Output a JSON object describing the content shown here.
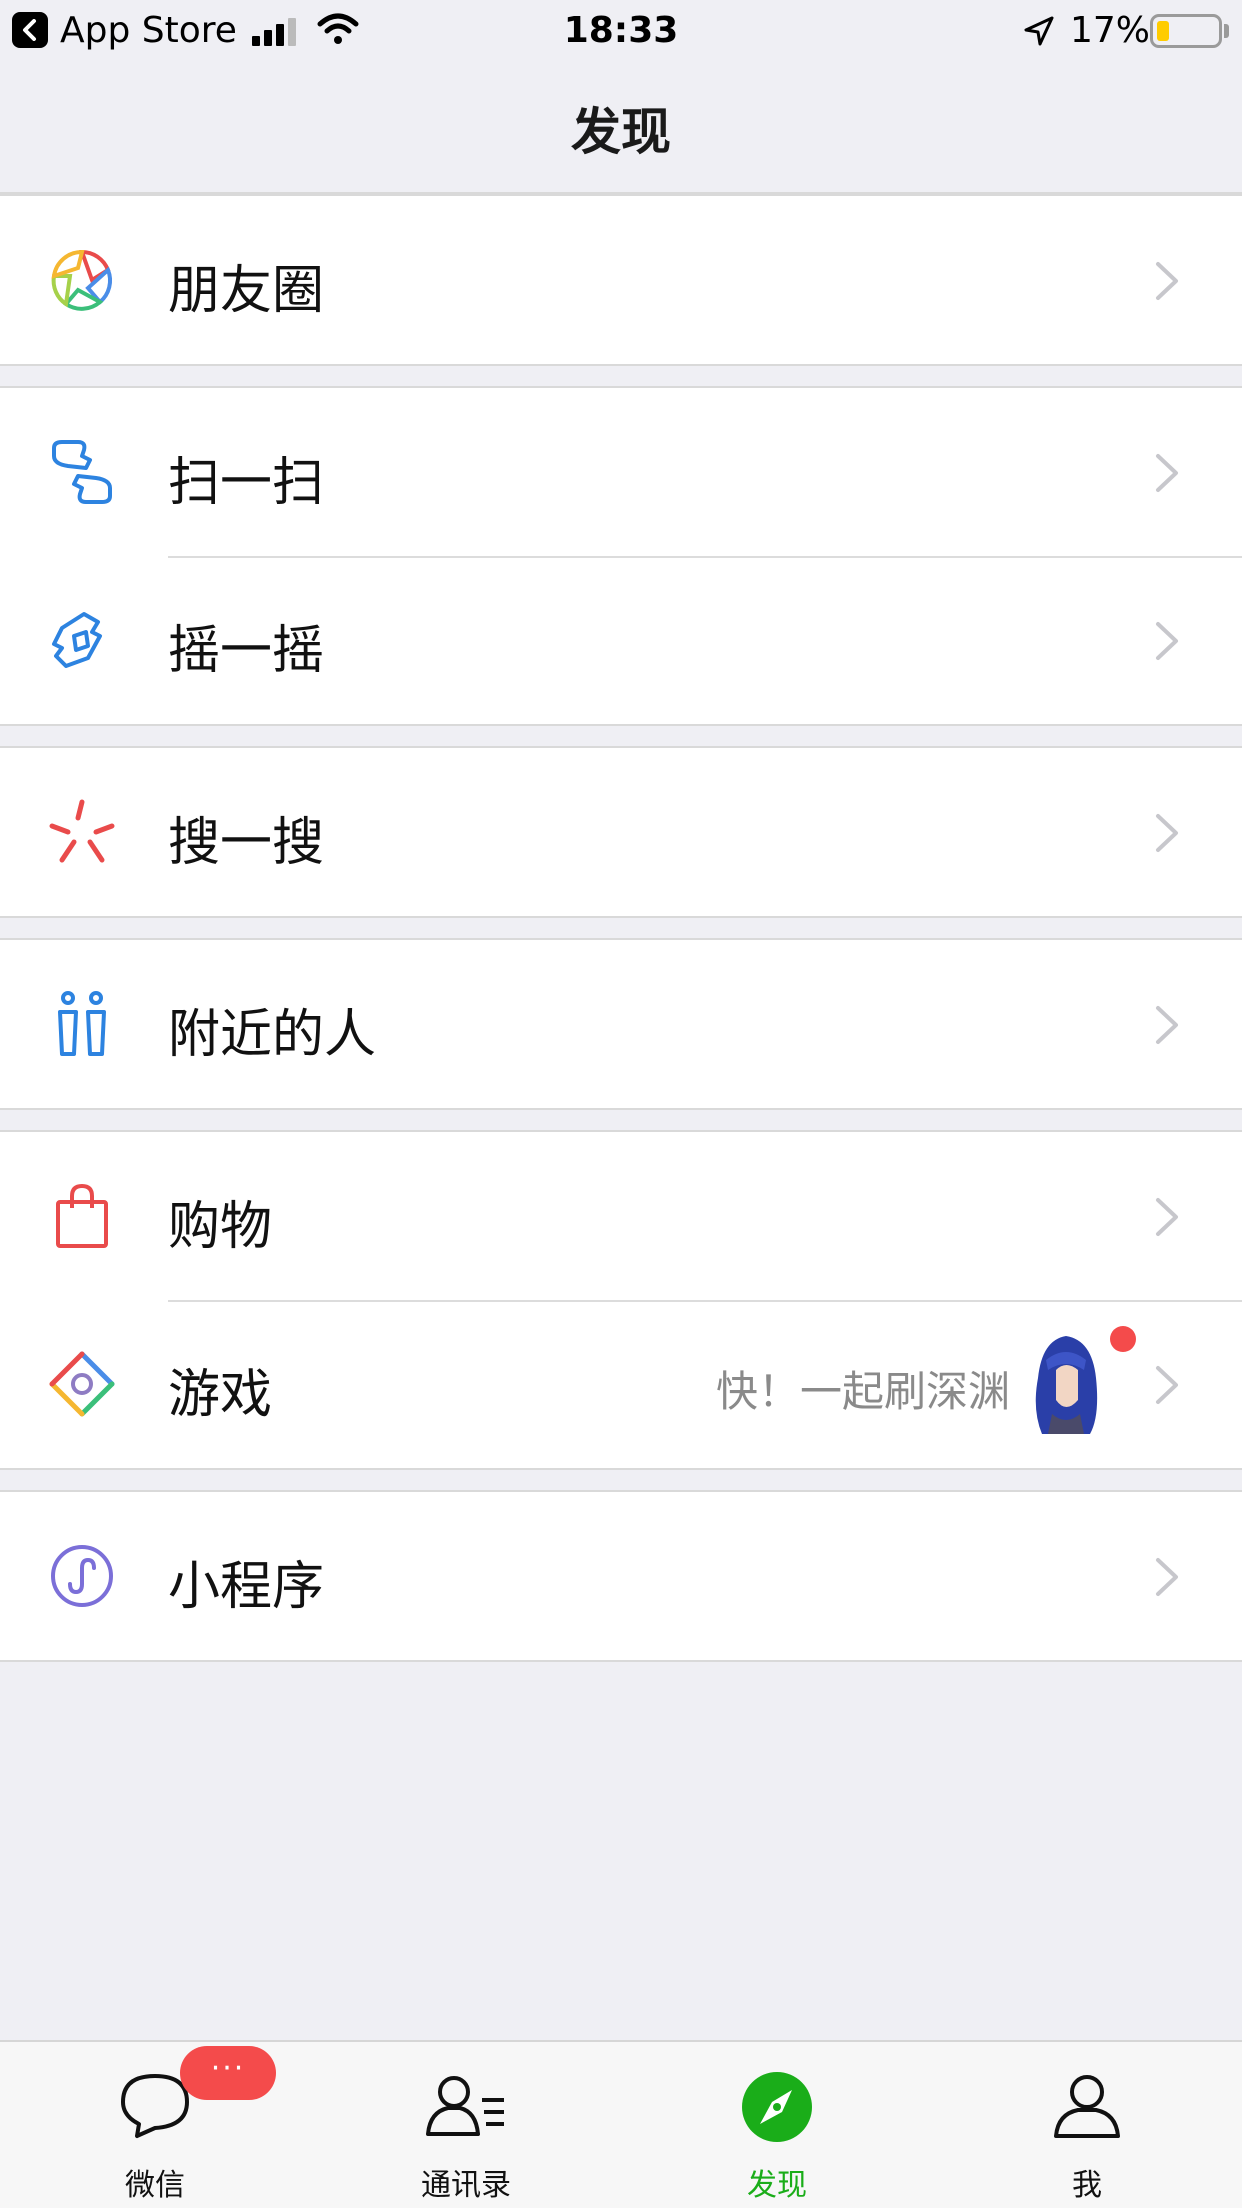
{
  "status_bar": {
    "back_app": "App Store",
    "time": "18:33",
    "battery": "17%",
    "icons": [
      "back-arrow-icon",
      "signal-icon",
      "wifi-icon",
      "location-icon",
      "battery-icon"
    ]
  },
  "nav": {
    "title": "发现"
  },
  "groups": [
    {
      "rows": [
        {
          "label": "朋友圈",
          "icon": "moments-icon"
        }
      ]
    },
    {
      "rows": [
        {
          "label": "扫一扫",
          "icon": "scan-icon"
        },
        {
          "label": "摇一摇",
          "icon": "shake-icon"
        }
      ]
    },
    {
      "rows": [
        {
          "label": "搜一搜",
          "icon": "search-icon"
        }
      ]
    },
    {
      "rows": [
        {
          "label": "附近的人",
          "icon": "people-nearby-icon"
        }
      ]
    },
    {
      "rows": [
        {
          "label": "购物",
          "icon": "shopping-bag-icon"
        },
        {
          "label": "游戏",
          "icon": "game-icon",
          "subtitle": "快！一起刷深渊"
        }
      ]
    },
    {
      "rows": [
        {
          "label": "小程序",
          "icon": "mini-program-icon"
        }
      ]
    }
  ],
  "tabs": [
    {
      "label": "微信",
      "icon": "chat-icon",
      "badge": "···"
    },
    {
      "label": "通讯录",
      "icon": "contacts-icon"
    },
    {
      "label": "发现",
      "icon": "discover-icon",
      "active": true
    },
    {
      "label": "我",
      "icon": "me-icon"
    }
  ],
  "colors": {
    "accent": "#1aad19",
    "badge": "#f44b4b",
    "background": "#efeff4"
  }
}
